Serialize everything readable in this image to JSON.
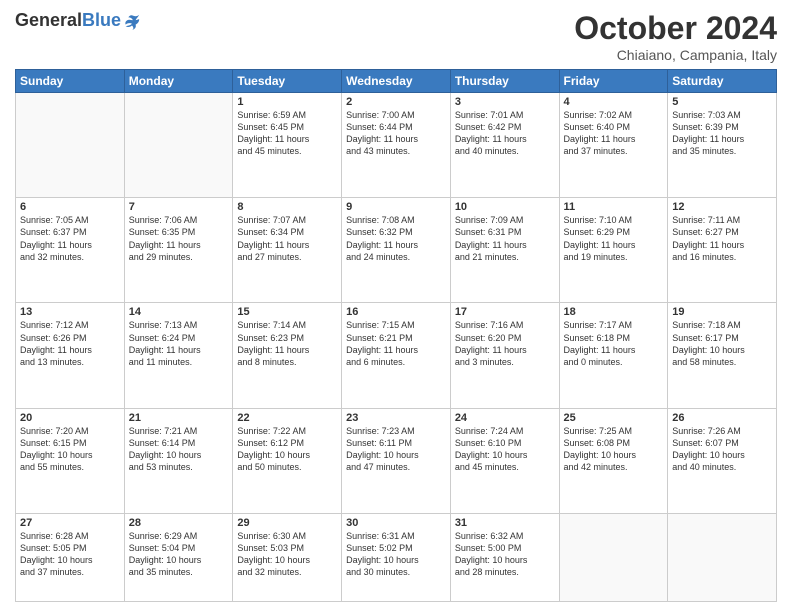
{
  "header": {
    "logo_general": "General",
    "logo_blue": "Blue",
    "title": "October 2024",
    "location": "Chiaiano, Campania, Italy"
  },
  "weekdays": [
    "Sunday",
    "Monday",
    "Tuesday",
    "Wednesday",
    "Thursday",
    "Friday",
    "Saturday"
  ],
  "weeks": [
    [
      {
        "day": "",
        "lines": []
      },
      {
        "day": "",
        "lines": []
      },
      {
        "day": "1",
        "lines": [
          "Sunrise: 6:59 AM",
          "Sunset: 6:45 PM",
          "Daylight: 11 hours",
          "and 45 minutes."
        ]
      },
      {
        "day": "2",
        "lines": [
          "Sunrise: 7:00 AM",
          "Sunset: 6:44 PM",
          "Daylight: 11 hours",
          "and 43 minutes."
        ]
      },
      {
        "day": "3",
        "lines": [
          "Sunrise: 7:01 AM",
          "Sunset: 6:42 PM",
          "Daylight: 11 hours",
          "and 40 minutes."
        ]
      },
      {
        "day": "4",
        "lines": [
          "Sunrise: 7:02 AM",
          "Sunset: 6:40 PM",
          "Daylight: 11 hours",
          "and 37 minutes."
        ]
      },
      {
        "day": "5",
        "lines": [
          "Sunrise: 7:03 AM",
          "Sunset: 6:39 PM",
          "Daylight: 11 hours",
          "and 35 minutes."
        ]
      }
    ],
    [
      {
        "day": "6",
        "lines": [
          "Sunrise: 7:05 AM",
          "Sunset: 6:37 PM",
          "Daylight: 11 hours",
          "and 32 minutes."
        ]
      },
      {
        "day": "7",
        "lines": [
          "Sunrise: 7:06 AM",
          "Sunset: 6:35 PM",
          "Daylight: 11 hours",
          "and 29 minutes."
        ]
      },
      {
        "day": "8",
        "lines": [
          "Sunrise: 7:07 AM",
          "Sunset: 6:34 PM",
          "Daylight: 11 hours",
          "and 27 minutes."
        ]
      },
      {
        "day": "9",
        "lines": [
          "Sunrise: 7:08 AM",
          "Sunset: 6:32 PM",
          "Daylight: 11 hours",
          "and 24 minutes."
        ]
      },
      {
        "day": "10",
        "lines": [
          "Sunrise: 7:09 AM",
          "Sunset: 6:31 PM",
          "Daylight: 11 hours",
          "and 21 minutes."
        ]
      },
      {
        "day": "11",
        "lines": [
          "Sunrise: 7:10 AM",
          "Sunset: 6:29 PM",
          "Daylight: 11 hours",
          "and 19 minutes."
        ]
      },
      {
        "day": "12",
        "lines": [
          "Sunrise: 7:11 AM",
          "Sunset: 6:27 PM",
          "Daylight: 11 hours",
          "and 16 minutes."
        ]
      }
    ],
    [
      {
        "day": "13",
        "lines": [
          "Sunrise: 7:12 AM",
          "Sunset: 6:26 PM",
          "Daylight: 11 hours",
          "and 13 minutes."
        ]
      },
      {
        "day": "14",
        "lines": [
          "Sunrise: 7:13 AM",
          "Sunset: 6:24 PM",
          "Daylight: 11 hours",
          "and 11 minutes."
        ]
      },
      {
        "day": "15",
        "lines": [
          "Sunrise: 7:14 AM",
          "Sunset: 6:23 PM",
          "Daylight: 11 hours",
          "and 8 minutes."
        ]
      },
      {
        "day": "16",
        "lines": [
          "Sunrise: 7:15 AM",
          "Sunset: 6:21 PM",
          "Daylight: 11 hours",
          "and 6 minutes."
        ]
      },
      {
        "day": "17",
        "lines": [
          "Sunrise: 7:16 AM",
          "Sunset: 6:20 PM",
          "Daylight: 11 hours",
          "and 3 minutes."
        ]
      },
      {
        "day": "18",
        "lines": [
          "Sunrise: 7:17 AM",
          "Sunset: 6:18 PM",
          "Daylight: 11 hours",
          "and 0 minutes."
        ]
      },
      {
        "day": "19",
        "lines": [
          "Sunrise: 7:18 AM",
          "Sunset: 6:17 PM",
          "Daylight: 10 hours",
          "and 58 minutes."
        ]
      }
    ],
    [
      {
        "day": "20",
        "lines": [
          "Sunrise: 7:20 AM",
          "Sunset: 6:15 PM",
          "Daylight: 10 hours",
          "and 55 minutes."
        ]
      },
      {
        "day": "21",
        "lines": [
          "Sunrise: 7:21 AM",
          "Sunset: 6:14 PM",
          "Daylight: 10 hours",
          "and 53 minutes."
        ]
      },
      {
        "day": "22",
        "lines": [
          "Sunrise: 7:22 AM",
          "Sunset: 6:12 PM",
          "Daylight: 10 hours",
          "and 50 minutes."
        ]
      },
      {
        "day": "23",
        "lines": [
          "Sunrise: 7:23 AM",
          "Sunset: 6:11 PM",
          "Daylight: 10 hours",
          "and 47 minutes."
        ]
      },
      {
        "day": "24",
        "lines": [
          "Sunrise: 7:24 AM",
          "Sunset: 6:10 PM",
          "Daylight: 10 hours",
          "and 45 minutes."
        ]
      },
      {
        "day": "25",
        "lines": [
          "Sunrise: 7:25 AM",
          "Sunset: 6:08 PM",
          "Daylight: 10 hours",
          "and 42 minutes."
        ]
      },
      {
        "day": "26",
        "lines": [
          "Sunrise: 7:26 AM",
          "Sunset: 6:07 PM",
          "Daylight: 10 hours",
          "and 40 minutes."
        ]
      }
    ],
    [
      {
        "day": "27",
        "lines": [
          "Sunrise: 6:28 AM",
          "Sunset: 5:05 PM",
          "Daylight: 10 hours",
          "and 37 minutes."
        ]
      },
      {
        "day": "28",
        "lines": [
          "Sunrise: 6:29 AM",
          "Sunset: 5:04 PM",
          "Daylight: 10 hours",
          "and 35 minutes."
        ]
      },
      {
        "day": "29",
        "lines": [
          "Sunrise: 6:30 AM",
          "Sunset: 5:03 PM",
          "Daylight: 10 hours",
          "and 32 minutes."
        ]
      },
      {
        "day": "30",
        "lines": [
          "Sunrise: 6:31 AM",
          "Sunset: 5:02 PM",
          "Daylight: 10 hours",
          "and 30 minutes."
        ]
      },
      {
        "day": "31",
        "lines": [
          "Sunrise: 6:32 AM",
          "Sunset: 5:00 PM",
          "Daylight: 10 hours",
          "and 28 minutes."
        ]
      },
      {
        "day": "",
        "lines": []
      },
      {
        "day": "",
        "lines": []
      }
    ]
  ]
}
